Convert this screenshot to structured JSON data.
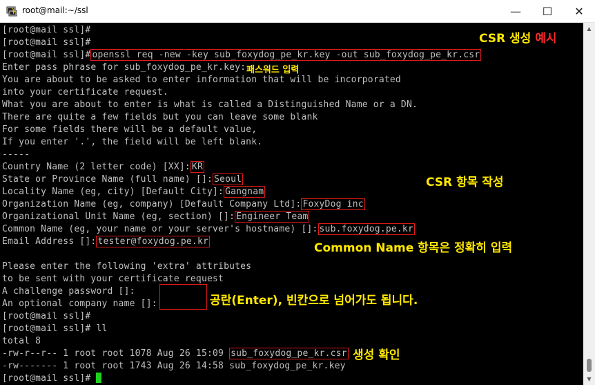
{
  "window": {
    "title": "root@mail:~/ssl",
    "icon": "putty-terminal-icon",
    "minimize": "—",
    "maximize": "☐",
    "close": "✕"
  },
  "prompt": "[root@mail ssl]#",
  "lines": {
    "l1": "[root@mail ssl]#",
    "l2": "[root@mail ssl]#",
    "l3_cmd": "openssl req -new -key sub_foxydog_pe_kr.key -out sub_foxydog_pe_kr.csr",
    "l4": "Enter pass phrase for sub_foxydog_pe_kr.key:",
    "l5": "You are about to be asked to enter information that will be incorporated",
    "l6": "into your certificate request.",
    "l7": "What you are about to enter is what is called a Distinguished Name or a DN.",
    "l8": "There are quite a few fields but you can leave some blank",
    "l9": "For some fields there will be a default value,",
    "l10": "If you enter '.', the field will be left blank.",
    "l11": "-----",
    "country_label": "Country Name (2 letter code) [XX]:",
    "country_value": "KR",
    "state_label": "State or Province Name (full name) []:",
    "state_value": "Seoul",
    "locality_label": "Locality Name (eg, city) [Default City]:",
    "locality_value": "Gangnam",
    "org_label": "Organization Name (eg, company) [Default Company Ltd]:",
    "org_value": "FoxyDog inc",
    "unit_label": "Organizational Unit Name (eg, section) []:",
    "unit_value": "Engineer Team",
    "cn_label": "Common Name (eg, your name or your server's hostname) []:",
    "cn_value": "sub.foxydog.pe.kr",
    "email_label": "Email Address []:",
    "email_value": "tester@foxydog.pe.kr",
    "extra1": "Please enter the following 'extra' attributes",
    "extra2": "to be sent with your certificate request",
    "challenge": "A challenge password []:",
    "optional_company": "An optional company name []:",
    "p1": "[root@mail ssl]#",
    "p2_prompt": "[root@mail ssl]#",
    "p2_cmd": " ll",
    "total": "total 8",
    "ls1_meta": "-rw-r--r-- 1 root root 1078 Aug 26 15:09",
    "ls1_file": "sub_foxydog_pe_kr.csr",
    "ls2": "-rw------- 1 root root 1743 Aug 26 14:58 sub_foxydog_pe_kr.key",
    "last_prompt": "[root@mail ssl]#"
  },
  "annotations": {
    "csr_example_a": "CSR 생성 ",
    "csr_example_b": "예시",
    "passphrase": "패스워드 입력",
    "csr_fields": "CSR 항목 작성",
    "common_name": "Common Name 항목은 정확히 입력",
    "blank": "공란(Enter), 빈칸으로 넘어가도 됩니다.",
    "generated": "생성 확인"
  },
  "colors": {
    "terminal_bg": "#000000",
    "terminal_text": "#c0c0c0",
    "annotation": "#ffe800",
    "highlight_box": "#e01919",
    "cursor": "#1fd11f"
  }
}
